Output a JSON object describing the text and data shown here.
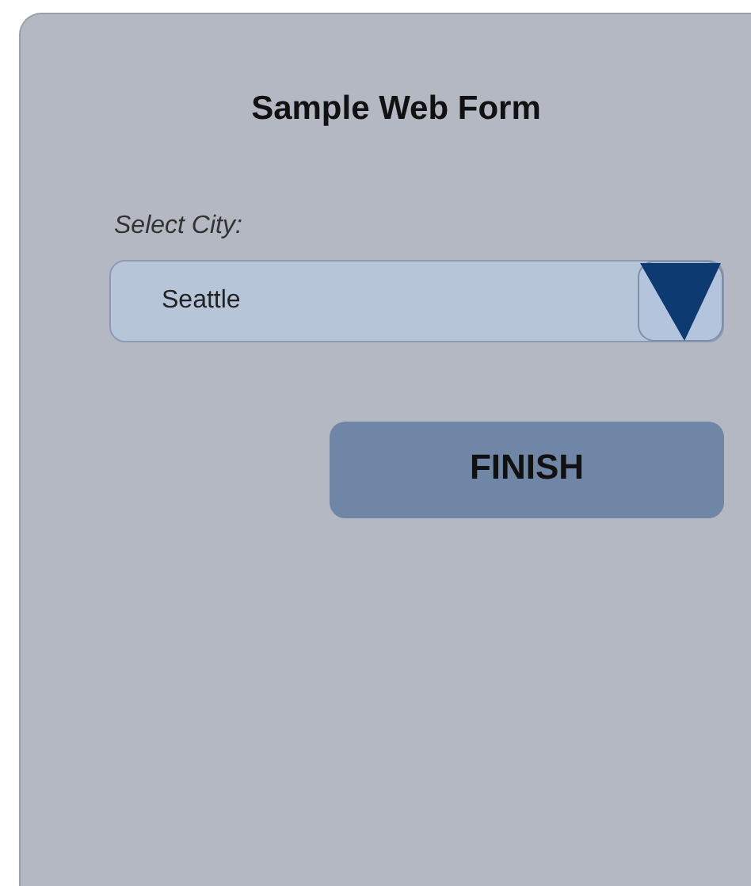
{
  "form": {
    "title": "Sample Web Form",
    "city_label": "Select City:",
    "city_value": "Seattle",
    "button": "FINISH"
  }
}
